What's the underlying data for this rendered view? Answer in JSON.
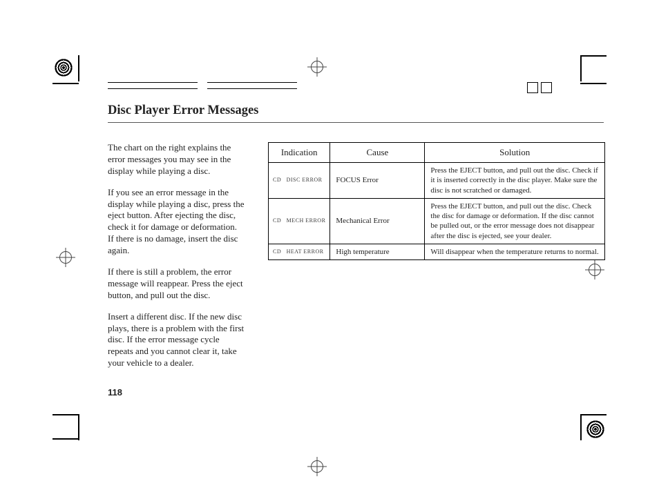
{
  "title": "Disc Player Error Messages",
  "paragraphs": [
    "The chart on the right explains the error messages you may see in the display while playing a disc.",
    "If you see an error message in the display while playing a disc, press the eject button. After ejecting the disc, check it for damage or deformation. If there is no damage, insert the disc again.",
    "If there is still a problem, the error message will reappear. Press the eject button, and pull out the disc.",
    "Insert a different disc. If the new disc plays, there is a problem with the first disc. If the error message cycle repeats and you cannot clear it, take your vehicle to a dealer."
  ],
  "headers": {
    "indication": "Indication",
    "cause": "Cause",
    "solution": "Solution"
  },
  "rows": [
    {
      "indication": "CD   DISC ERROR",
      "cause": "FOCUS Error",
      "solution": "Press the EJECT button, and pull out the disc. Check if it is inserted correctly in the disc player.\nMake sure the disc is not scratched or damaged."
    },
    {
      "indication": "CD   MECH ERROR",
      "cause": "Mechanical Error",
      "solution": "Press the EJECT button, and pull out the disc. Check the disc for damage or deformation.\nIf the disc cannot be pulled out, or the error message does not disappear after the disc is ejected, see your dealer."
    },
    {
      "indication": "CD   HEAT ERROR",
      "cause": "High temperature",
      "solution": "Will disappear when the temperature returns to normal."
    }
  ],
  "page_number": "118",
  "chart_data": {
    "type": "table",
    "title": "Disc Player Error Messages",
    "columns": [
      "Indication",
      "Cause",
      "Solution"
    ],
    "rows": [
      [
        "CD   DISC ERROR",
        "FOCUS Error",
        "Press the EJECT button, and pull out the disc. Check if it is inserted correctly in the disc player. Make sure the disc is not scratched or damaged."
      ],
      [
        "CD   MECH ERROR",
        "Mechanical Error",
        "Press the EJECT button, and pull out the disc. Check the disc for damage or deformation. If the disc cannot be pulled out, or the error message does not disappear after the disc is ejected, see your dealer."
      ],
      [
        "CD   HEAT ERROR",
        "High temperature",
        "Will disappear when the temperature returns to normal."
      ]
    ]
  }
}
